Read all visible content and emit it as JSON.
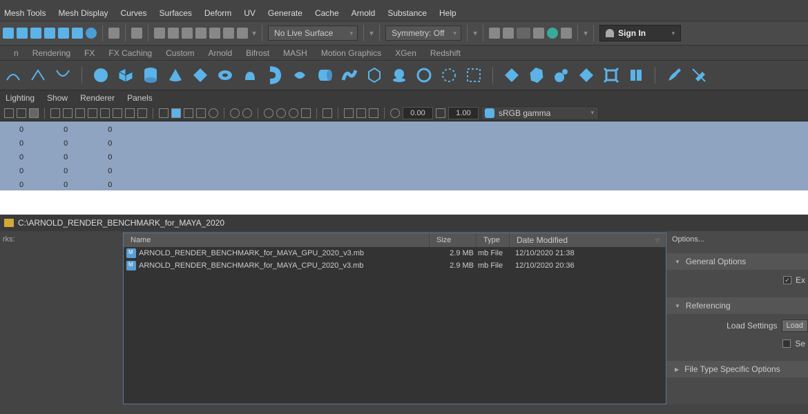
{
  "menubar": [
    "Mesh Tools",
    "Mesh Display",
    "Curves",
    "Surfaces",
    "Deform",
    "UV",
    "Generate",
    "Cache",
    "Arnold",
    "Substance",
    "Help"
  ],
  "toolbar1": {
    "live_surface": "No Live Surface",
    "symmetry": "Symmetry: Off",
    "signin": "Sign In"
  },
  "shelftabs": [
    "n",
    "Rendering",
    "FX",
    "FX Caching",
    "Custom",
    "Arnold",
    "Bifrost",
    "MASH",
    "Motion Graphics",
    "XGen",
    "Redshift"
  ],
  "panelmenu": [
    "Lighting",
    "Show",
    "Renderer",
    "Panels"
  ],
  "viewtoolbar": {
    "val1": "0.00",
    "val2": "1.00",
    "colorspace": "sRGB gamma"
  },
  "viewport_grid": [
    [
      "0",
      "0",
      "0"
    ],
    [
      "0",
      "0",
      "0"
    ],
    [
      "0",
      "0",
      "0"
    ],
    [
      "0",
      "0",
      "0"
    ],
    [
      "0",
      "0",
      "0"
    ]
  ],
  "filebrowser": {
    "path": "C:\\ARNOLD_RENDER_BENCHMARK_for_MAYA_2020",
    "left_label": "rks:",
    "cols": [
      "Name",
      "Size",
      "Type",
      "Date Modified"
    ],
    "rows": [
      {
        "name": "ARNOLD_RENDER_BENCHMARK_for_MAYA_GPU_2020_v3.mb",
        "size": "2.9 MB",
        "type": "mb File",
        "date": "12/10/2020 21:38"
      },
      {
        "name": "ARNOLD_RENDER_BENCHMARK_for_MAYA_CPU_2020_v3.mb",
        "size": "2.9 MB",
        "type": "mb File",
        "date": "12/10/2020 20:36"
      }
    ]
  },
  "options": {
    "title": "Options...",
    "general": "General Options",
    "general_chk_label": "Ex",
    "referencing": "Referencing",
    "load_settings_label": "Load Settings",
    "load_btn": "Load",
    "ref_chk_label": "Se",
    "filetype": "File Type Specific Options"
  }
}
